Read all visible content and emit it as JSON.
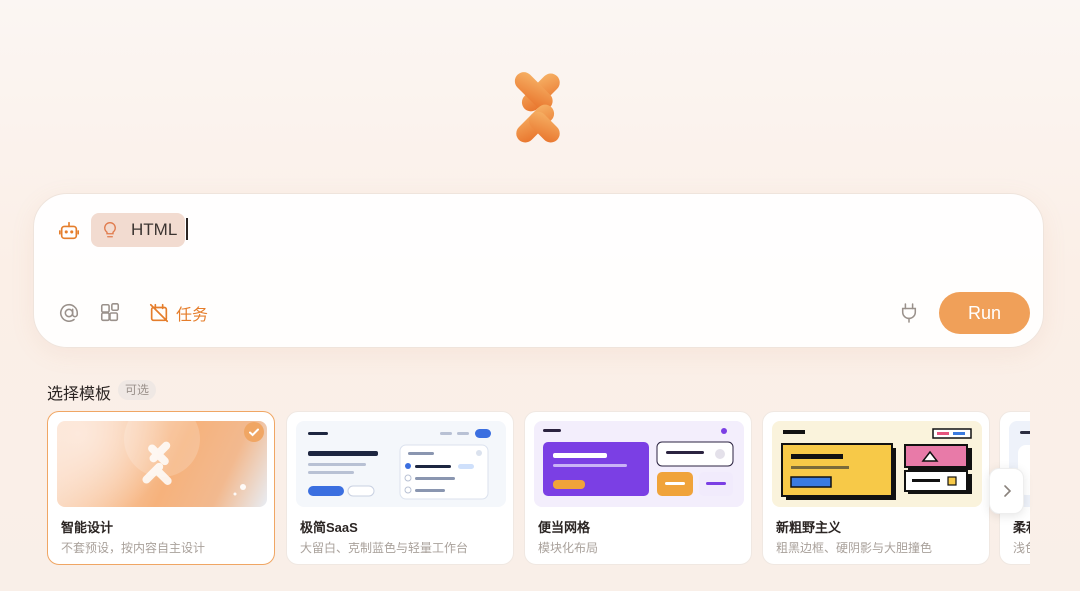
{
  "prompt": {
    "chip_label": "HTML",
    "task_label": "任务",
    "run_label": "Run"
  },
  "templates": {
    "section_title": "选择模板",
    "badge": "可选",
    "items": [
      {
        "name": "智能设计",
        "desc": "不套预设，按内容自主设计",
        "selected": true
      },
      {
        "name": "极简SaaS",
        "desc": "大留白、克制蓝色与轻量工作台",
        "selected": false
      },
      {
        "name": "便当网格",
        "desc": "模块化布局",
        "selected": false
      },
      {
        "name": "新粗野主义",
        "desc": "粗黑边框、硬阴影与大胆撞色",
        "selected": false
      },
      {
        "name": "柔和",
        "desc": "浅色",
        "selected": false
      }
    ]
  },
  "colors": {
    "accent": "#f0a059",
    "accent_text": "#e57d2b",
    "chip_bg": "#f2dbd0"
  },
  "icons": [
    "logo",
    "robot-icon",
    "lightbulb-icon",
    "at-icon",
    "apps-icon",
    "task-off-icon",
    "plug-icon",
    "check-icon",
    "chevron-right-icon"
  ]
}
